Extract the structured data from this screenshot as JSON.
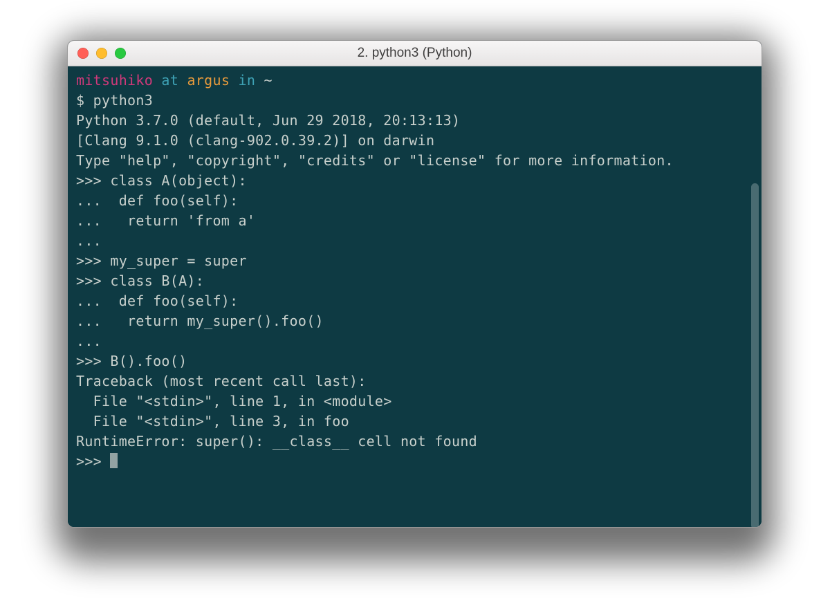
{
  "window": {
    "title": "2. python3 (Python)"
  },
  "prompt": {
    "user": "mitsuhiko",
    "at": "at",
    "host": "argus",
    "in": "in",
    "path": "~"
  },
  "lines": {
    "l01": "$ python3",
    "l02": "Python 3.7.0 (default, Jun 29 2018, 20:13:13)",
    "l03": "[Clang 9.1.0 (clang-902.0.39.2)] on darwin",
    "l04": "Type \"help\", \"copyright\", \"credits\" or \"license\" for more information.",
    "l05": ">>> class A(object):",
    "l06": "...  def foo(self):",
    "l07": "...   return 'from a'",
    "l08": "...",
    "l09": ">>> my_super = super",
    "l10": ">>> class B(A):",
    "l11": "...  def foo(self):",
    "l12": "...   return my_super().foo()",
    "l13": "...",
    "l14": ">>> B().foo()",
    "l15": "Traceback (most recent call last):",
    "l16": "  File \"<stdin>\", line 1, in <module>",
    "l17": "  File \"<stdin>\", line 3, in foo",
    "l18": "RuntimeError: super(): __class__ cell not found",
    "l19": ">>> "
  }
}
